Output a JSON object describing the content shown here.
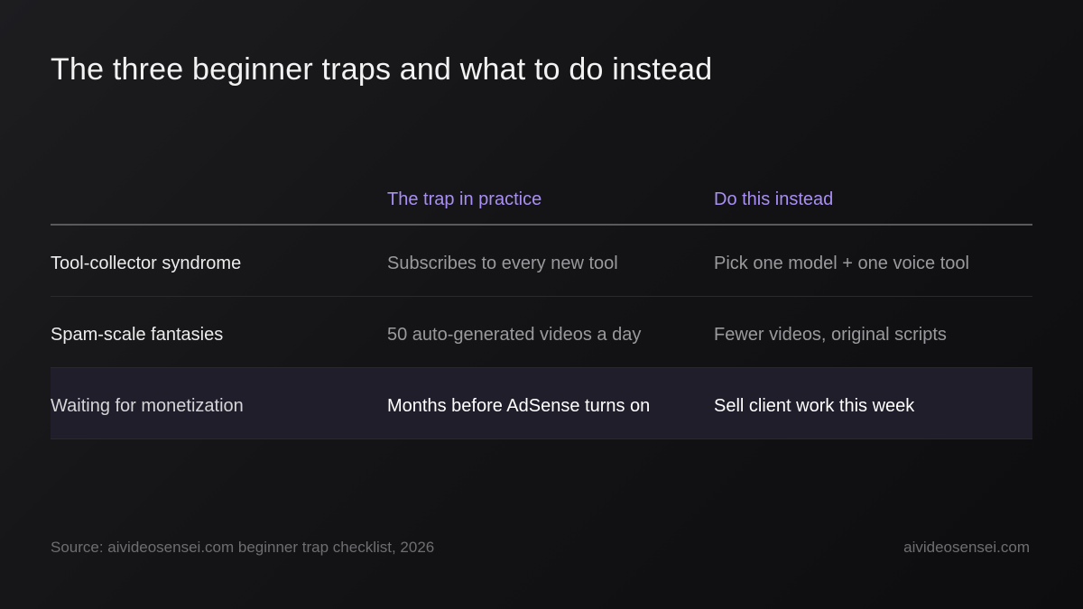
{
  "title": "The three beginner traps and what to do instead",
  "table": {
    "headers": [
      "",
      "The trap in practice",
      "Do this instead"
    ],
    "rows": [
      {
        "name": "Tool-collector syndrome",
        "trap": "Subscribes to every new tool",
        "instead": "Pick one model + one voice tool",
        "highlighted": false
      },
      {
        "name": "Spam-scale fantasies",
        "trap": "50 auto-generated videos a day",
        "instead": "Fewer videos, original scripts",
        "highlighted": false
      },
      {
        "name": "Waiting for monetization",
        "trap": "Months before AdSense turns on",
        "instead": "Sell client work this week",
        "highlighted": true
      }
    ]
  },
  "footer": {
    "source": "Source: aivideosensei.com beginner trap checklist, 2026",
    "site": "aivideosensei.com"
  },
  "colors": {
    "accent": "#a98ff5",
    "highlight_row": "#201e2b"
  }
}
